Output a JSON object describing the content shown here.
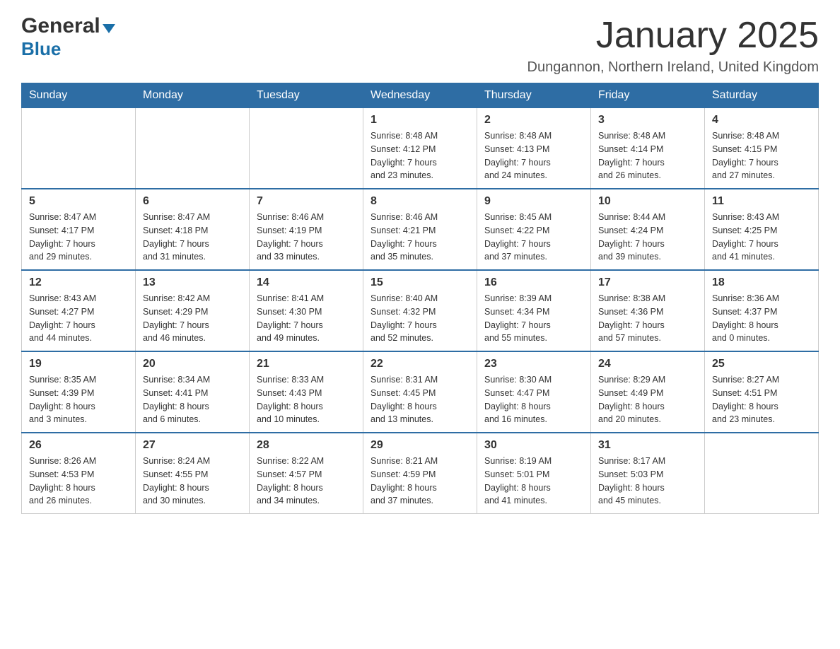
{
  "header": {
    "logo_general": "General",
    "logo_blue": "Blue",
    "title": "January 2025",
    "location": "Dungannon, Northern Ireland, United Kingdom"
  },
  "days_of_week": [
    "Sunday",
    "Monday",
    "Tuesday",
    "Wednesday",
    "Thursday",
    "Friday",
    "Saturday"
  ],
  "weeks": [
    {
      "days": [
        {
          "num": "",
          "info": ""
        },
        {
          "num": "",
          "info": ""
        },
        {
          "num": "",
          "info": ""
        },
        {
          "num": "1",
          "info": "Sunrise: 8:48 AM\nSunset: 4:12 PM\nDaylight: 7 hours\nand 23 minutes."
        },
        {
          "num": "2",
          "info": "Sunrise: 8:48 AM\nSunset: 4:13 PM\nDaylight: 7 hours\nand 24 minutes."
        },
        {
          "num": "3",
          "info": "Sunrise: 8:48 AM\nSunset: 4:14 PM\nDaylight: 7 hours\nand 26 minutes."
        },
        {
          "num": "4",
          "info": "Sunrise: 8:48 AM\nSunset: 4:15 PM\nDaylight: 7 hours\nand 27 minutes."
        }
      ]
    },
    {
      "days": [
        {
          "num": "5",
          "info": "Sunrise: 8:47 AM\nSunset: 4:17 PM\nDaylight: 7 hours\nand 29 minutes."
        },
        {
          "num": "6",
          "info": "Sunrise: 8:47 AM\nSunset: 4:18 PM\nDaylight: 7 hours\nand 31 minutes."
        },
        {
          "num": "7",
          "info": "Sunrise: 8:46 AM\nSunset: 4:19 PM\nDaylight: 7 hours\nand 33 minutes."
        },
        {
          "num": "8",
          "info": "Sunrise: 8:46 AM\nSunset: 4:21 PM\nDaylight: 7 hours\nand 35 minutes."
        },
        {
          "num": "9",
          "info": "Sunrise: 8:45 AM\nSunset: 4:22 PM\nDaylight: 7 hours\nand 37 minutes."
        },
        {
          "num": "10",
          "info": "Sunrise: 8:44 AM\nSunset: 4:24 PM\nDaylight: 7 hours\nand 39 minutes."
        },
        {
          "num": "11",
          "info": "Sunrise: 8:43 AM\nSunset: 4:25 PM\nDaylight: 7 hours\nand 41 minutes."
        }
      ]
    },
    {
      "days": [
        {
          "num": "12",
          "info": "Sunrise: 8:43 AM\nSunset: 4:27 PM\nDaylight: 7 hours\nand 44 minutes."
        },
        {
          "num": "13",
          "info": "Sunrise: 8:42 AM\nSunset: 4:29 PM\nDaylight: 7 hours\nand 46 minutes."
        },
        {
          "num": "14",
          "info": "Sunrise: 8:41 AM\nSunset: 4:30 PM\nDaylight: 7 hours\nand 49 minutes."
        },
        {
          "num": "15",
          "info": "Sunrise: 8:40 AM\nSunset: 4:32 PM\nDaylight: 7 hours\nand 52 minutes."
        },
        {
          "num": "16",
          "info": "Sunrise: 8:39 AM\nSunset: 4:34 PM\nDaylight: 7 hours\nand 55 minutes."
        },
        {
          "num": "17",
          "info": "Sunrise: 8:38 AM\nSunset: 4:36 PM\nDaylight: 7 hours\nand 57 minutes."
        },
        {
          "num": "18",
          "info": "Sunrise: 8:36 AM\nSunset: 4:37 PM\nDaylight: 8 hours\nand 0 minutes."
        }
      ]
    },
    {
      "days": [
        {
          "num": "19",
          "info": "Sunrise: 8:35 AM\nSunset: 4:39 PM\nDaylight: 8 hours\nand 3 minutes."
        },
        {
          "num": "20",
          "info": "Sunrise: 8:34 AM\nSunset: 4:41 PM\nDaylight: 8 hours\nand 6 minutes."
        },
        {
          "num": "21",
          "info": "Sunrise: 8:33 AM\nSunset: 4:43 PM\nDaylight: 8 hours\nand 10 minutes."
        },
        {
          "num": "22",
          "info": "Sunrise: 8:31 AM\nSunset: 4:45 PM\nDaylight: 8 hours\nand 13 minutes."
        },
        {
          "num": "23",
          "info": "Sunrise: 8:30 AM\nSunset: 4:47 PM\nDaylight: 8 hours\nand 16 minutes."
        },
        {
          "num": "24",
          "info": "Sunrise: 8:29 AM\nSunset: 4:49 PM\nDaylight: 8 hours\nand 20 minutes."
        },
        {
          "num": "25",
          "info": "Sunrise: 8:27 AM\nSunset: 4:51 PM\nDaylight: 8 hours\nand 23 minutes."
        }
      ]
    },
    {
      "days": [
        {
          "num": "26",
          "info": "Sunrise: 8:26 AM\nSunset: 4:53 PM\nDaylight: 8 hours\nand 26 minutes."
        },
        {
          "num": "27",
          "info": "Sunrise: 8:24 AM\nSunset: 4:55 PM\nDaylight: 8 hours\nand 30 minutes."
        },
        {
          "num": "28",
          "info": "Sunrise: 8:22 AM\nSunset: 4:57 PM\nDaylight: 8 hours\nand 34 minutes."
        },
        {
          "num": "29",
          "info": "Sunrise: 8:21 AM\nSunset: 4:59 PM\nDaylight: 8 hours\nand 37 minutes."
        },
        {
          "num": "30",
          "info": "Sunrise: 8:19 AM\nSunset: 5:01 PM\nDaylight: 8 hours\nand 41 minutes."
        },
        {
          "num": "31",
          "info": "Sunrise: 8:17 AM\nSunset: 5:03 PM\nDaylight: 8 hours\nand 45 minutes."
        },
        {
          "num": "",
          "info": ""
        }
      ]
    }
  ]
}
